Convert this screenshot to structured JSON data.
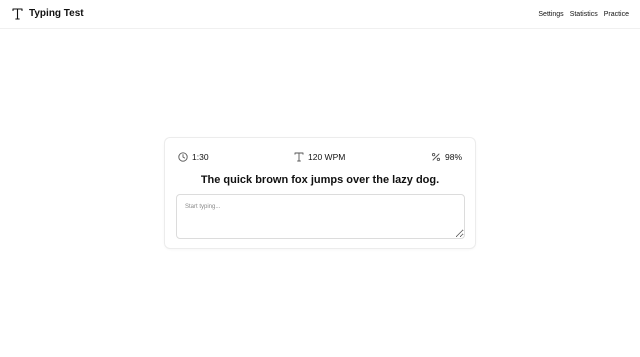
{
  "app": {
    "title": "Typing Test",
    "logo_icon": "type-icon"
  },
  "nav": {
    "items": [
      "Settings",
      "Statistics",
      "Practice"
    ]
  },
  "stats": {
    "time": {
      "icon": "clock-icon",
      "value": "1:30"
    },
    "wpm": {
      "icon": "type-icon",
      "value": "120 WPM"
    },
    "accuracy": {
      "icon": "percent-icon",
      "value": "98%"
    }
  },
  "prompt": {
    "sentence": "The quick brown fox jumps over the lazy dog."
  },
  "input": {
    "placeholder": "Start typing...",
    "value": ""
  }
}
